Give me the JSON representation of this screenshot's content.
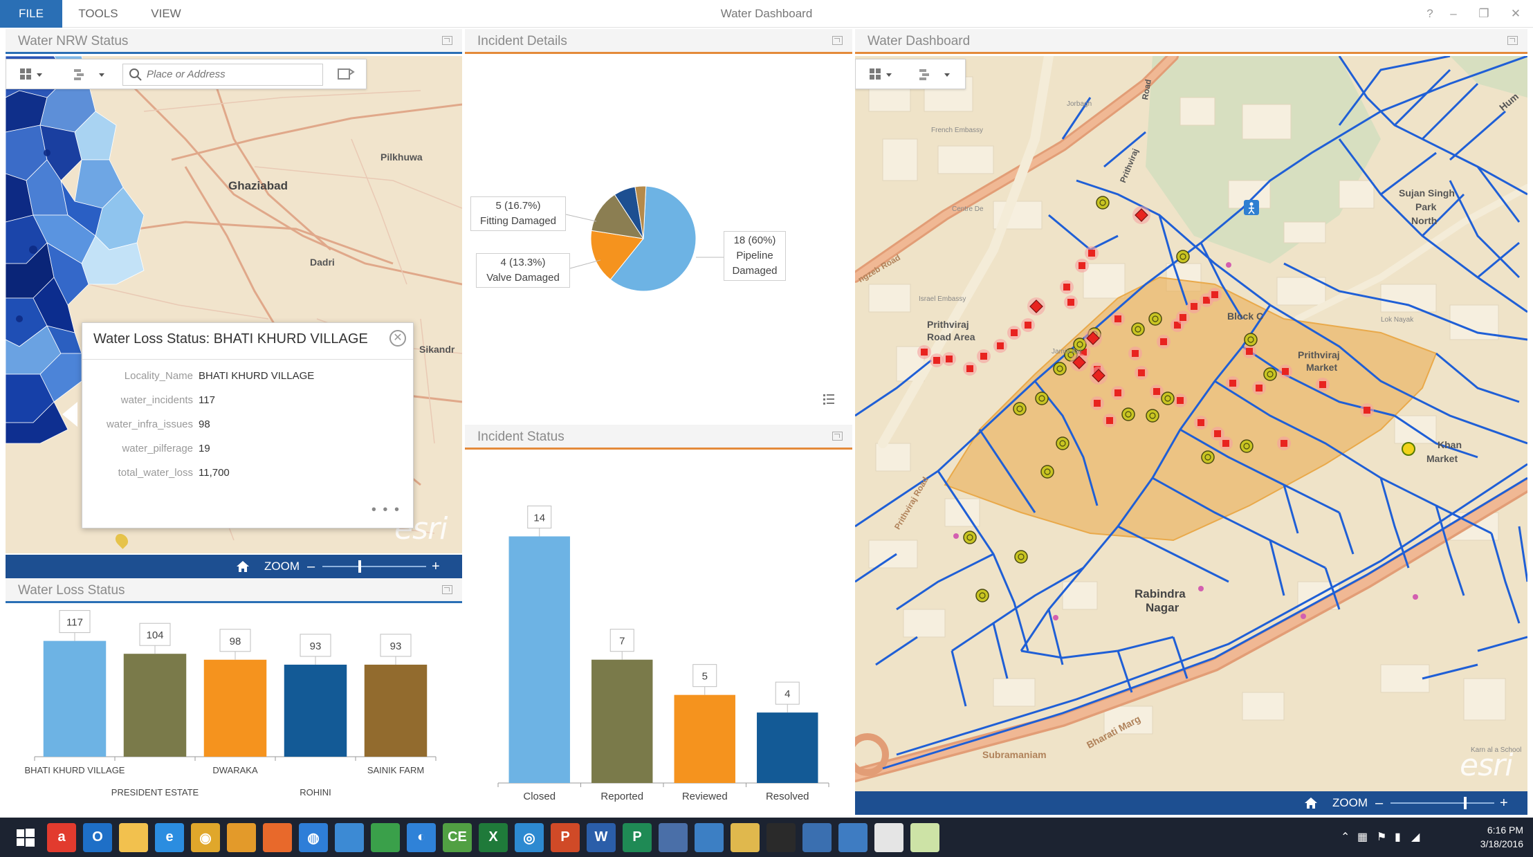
{
  "ribbon": {
    "tabs": [
      "FILE",
      "TOOLS",
      "VIEW"
    ],
    "title": "Water Dashboard",
    "controls": [
      "?",
      "–",
      "❐",
      "✕"
    ]
  },
  "nrw_panel": {
    "title": "Water NRW Status",
    "search_placeholder": "Place or Address",
    "labels": [
      "Pilkhuwa",
      "Ghaziabad",
      "Dadri",
      "Sikandr"
    ],
    "zoom_label": "ZOOM",
    "watermark": "esri"
  },
  "popup": {
    "title": "Water Loss Status: BHATI KHURD VILLAGE",
    "fields": [
      {
        "key": "Locality_Name",
        "value": "BHATI KHURD VILLAGE"
      },
      {
        "key": "water_incidents",
        "value": "117"
      },
      {
        "key": "water_infra_issues",
        "value": "98"
      },
      {
        "key": "water_pilferage",
        "value": "19"
      },
      {
        "key": "total_water_loss",
        "value": "11,700"
      }
    ],
    "more": "• • •"
  },
  "water_loss_panel": {
    "title": "Water Loss Status"
  },
  "incident_details_panel": {
    "title": "Incident Details",
    "callouts": {
      "fitting": [
        "5 (16.7%)",
        "Fitting Damaged"
      ],
      "valve": [
        "4 (13.3%)",
        "Valve Damaged"
      ],
      "pipeline": [
        "18 (60%)",
        "Pipeline",
        "Damaged"
      ]
    }
  },
  "incident_status_panel": {
    "title": "Incident Status"
  },
  "water_dashboard_panel": {
    "title": "Water Dashboard",
    "labels": {
      "road_top": "Road",
      "prithviraj_road_1": "Prithviraj",
      "prithviraj_road_2": "Prithviraj Road",
      "aurangzeb": "ngzeb Road",
      "sujan_1": "Sujan Singh",
      "sujan_2": "Park",
      "sujan_3": "North",
      "prithviraj_area_1": "Prithviraj",
      "prithviraj_area_2": "Road Area",
      "block_c": "Block C",
      "prithviraj_market_1": "Prithviraj",
      "prithviraj_market_2": "Market",
      "khan_1": "Khan",
      "khan_2": "Market",
      "rabindra_1": "Rabindra",
      "rabindra_2": "Nagar",
      "subramaniam": "Subramaniam",
      "bharati_marg": "Bharati Marg",
      "hum": "Hum",
      "small_1": "Jorbagh",
      "small_2": "French Embassy",
      "small_3": "Centre De",
      "small_4": "Israel Embassy",
      "small_5": "Jamia Aid",
      "small_6": "Lok Nayak",
      "small_7": "Karn al a School"
    },
    "zoom_label": "ZOOM",
    "watermark": "esri"
  },
  "chart_data": [
    {
      "type": "bar",
      "title": "Water Loss Status",
      "categories": [
        "BHATI KHURD VILLAGE",
        "PRESIDENT ESTATE",
        "DWARAKA",
        "ROHINI",
        "SAINIK FARM"
      ],
      "values": [
        117,
        104,
        98,
        93,
        93
      ],
      "colors": [
        "#6db3e4",
        "#7a7a4a",
        "#f5931e",
        "#135a96",
        "#926b2e"
      ],
      "ylim": [
        0,
        130
      ],
      "grid": false
    },
    {
      "type": "pie",
      "title": "Incident Details",
      "categories": [
        "Pipeline Damaged",
        "Fitting Damaged",
        "Valve Damaged",
        "Other",
        "Other"
      ],
      "values": [
        18,
        5,
        4,
        2,
        1
      ],
      "colors": [
        "#6db3e4",
        "#f5931e",
        "#8b7e52",
        "#1d4f91",
        "#b58a4a"
      ]
    },
    {
      "type": "bar",
      "title": "Incident Status",
      "categories": [
        "Closed",
        "Reported",
        "Reviewed",
        "Resolved"
      ],
      "values": [
        14,
        7,
        5,
        4
      ],
      "colors": [
        "#6db3e4",
        "#7a7a4a",
        "#f5931e",
        "#135a96"
      ],
      "ylim": [
        0,
        15
      ],
      "grid": false
    }
  ],
  "taskbar": {
    "icons": [
      {
        "name": "windows-start-icon",
        "color": "#1c2331",
        "glyph": ""
      },
      {
        "name": "airtel-icon",
        "color": "#e23b2e",
        "glyph": "a"
      },
      {
        "name": "outlook-icon",
        "color": "#1e6fc7",
        "glyph": "O"
      },
      {
        "name": "file-explorer-icon",
        "color": "#f2c14e",
        "glyph": ""
      },
      {
        "name": "internet-explorer-icon",
        "color": "#2b8de0",
        "glyph": "e"
      },
      {
        "name": "chrome-icon",
        "color": "#e0a72b",
        "glyph": "◉"
      },
      {
        "name": "arcgis-pro-icon",
        "color": "#e39a2a",
        "glyph": ""
      },
      {
        "name": "firefox-icon",
        "color": "#e8692b",
        "glyph": ""
      },
      {
        "name": "globe-icon",
        "color": "#2e7ed8",
        "glyph": "◍"
      },
      {
        "name": "map-search-icon",
        "color": "#3c8ad4",
        "glyph": ""
      },
      {
        "name": "arcgis-earth-icon",
        "color": "#3aa04a",
        "glyph": ""
      },
      {
        "name": "ie-globe-icon",
        "color": "#2f82d8",
        "glyph": "◐"
      },
      {
        "name": "chart-app-icon",
        "color": "#51a043",
        "glyph": "CE"
      },
      {
        "name": "excel-icon",
        "color": "#1f7a3a",
        "glyph": "X"
      },
      {
        "name": "sync-icon",
        "color": "#2d8ad1",
        "glyph": "◎"
      },
      {
        "name": "powerpoint-icon",
        "color": "#d04a27",
        "glyph": "P"
      },
      {
        "name": "word-icon",
        "color": "#2b5ea9",
        "glyph": "W"
      },
      {
        "name": "publisher-icon",
        "color": "#1f8a55",
        "glyph": "P"
      },
      {
        "name": "satellite-icon",
        "color": "#4a6fa8",
        "glyph": ""
      },
      {
        "name": "book-icon",
        "color": "#3c7fc4",
        "glyph": ""
      },
      {
        "name": "folder-icon",
        "color": "#e0b84d",
        "glyph": ""
      },
      {
        "name": "phone-icon",
        "color": "#2a2a2a",
        "glyph": ""
      },
      {
        "name": "people-icon",
        "color": "#3a6fb0",
        "glyph": ""
      },
      {
        "name": "remote-desktop-icon",
        "color": "#3e7cc2",
        "glyph": ""
      },
      {
        "name": "explorer-window-icon",
        "color": "#e5e5e5",
        "glyph": ""
      },
      {
        "name": "notepad-icon",
        "color": "#cde3a6",
        "glyph": ""
      }
    ],
    "time": "6:16 PM",
    "date": "3/18/2016"
  },
  "colors": {
    "accent": "#2a6fb5",
    "zoom_bar": "#1d4f91",
    "pipe": "#1f5fd6",
    "incident": "#e8231f",
    "valve": "#a8a410",
    "zone_fill": "#e9a94a"
  }
}
